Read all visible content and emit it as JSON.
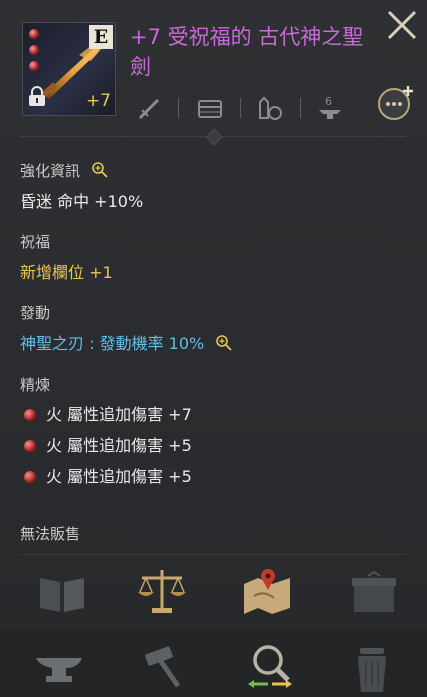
{
  "item": {
    "grade": "E",
    "enhance": "+7",
    "title": "+7 受祝福的 古代神之聖劍"
  },
  "sections": {
    "enhance_info": {
      "label": "強化資訊",
      "value": "昏迷 命中 +10%"
    },
    "blessing": {
      "label": "祝福",
      "value": "新增欄位 +1"
    },
    "activate": {
      "label": "發動",
      "value": "神聖之刃 : 發動機率 10%"
    },
    "refine": {
      "label": "精煉",
      "items": [
        "火 屬性追加傷害 +7",
        "火 屬性追加傷害 +5",
        "火 屬性追加傷害 +5"
      ]
    }
  },
  "footer": {
    "unsellable": "無法販售"
  },
  "icons": {
    "top_row": [
      "sword-icon",
      "chest-icon",
      "castle-bag-icon",
      "anvil-6-icon"
    ],
    "actions": [
      "book-icon",
      "scales-icon",
      "map-icon",
      "box-icon"
    ],
    "bottom": [
      "anvil-icon",
      "hammer-icon",
      "magnify-swap-icon",
      "trash-icon"
    ]
  }
}
